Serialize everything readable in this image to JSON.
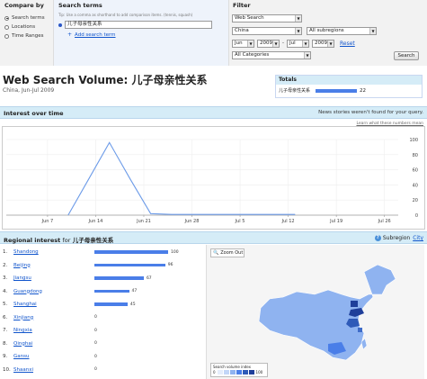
{
  "compare": {
    "heading": "Compare by",
    "options": [
      "Search terms",
      "Locations",
      "Time Ranges"
    ]
  },
  "terms": {
    "heading": "Search terms",
    "tip": "Tip: Use a comma as shorthand to add comparison items. (tennis, squash)",
    "term_value": "儿子母亲性关系",
    "add_label": "Add search term"
  },
  "filter": {
    "heading": "Filter",
    "property": "Web Search",
    "country": "China",
    "subregion": "All subregions",
    "from_month": "Jun",
    "from_year": "2009",
    "to_month": "Jul",
    "to_year": "2009",
    "category": "All Categories",
    "reset_label": "Reset",
    "search_label": "Search"
  },
  "header": {
    "title": "Web Search Volume: 儿子母亲性关系",
    "subtitle": "China, Jun-Jul 2009"
  },
  "totals": {
    "heading": "Totals",
    "term": "儿子母亲性关系",
    "value": "22",
    "bar_fraction": 1.0
  },
  "interest": {
    "heading": "Interest over time",
    "news_note": "News stories weren't found for your query.",
    "learn_link": "Learn what these numbers mean"
  },
  "chart_data": {
    "type": "line",
    "x": [
      "Jun 1",
      "Jun 4",
      "Jun 7",
      "Jun 10",
      "Jun 13",
      "Jun 16",
      "Jun 19",
      "Jun 22",
      "Jun 25",
      "Jun 28",
      "Jul 1",
      "Jul 4",
      "Jul 7",
      "Jul 10",
      "Jul 13",
      "Jul 16",
      "Jul 19",
      "Jul 22",
      "Jul 25",
      "Jul 28"
    ],
    "series": [
      {
        "values": [
          null,
          null,
          null,
          0,
          48,
          96,
          48,
          2,
          1,
          1,
          1,
          1,
          1,
          1,
          1,
          null,
          null,
          null,
          null,
          null
        ]
      }
    ],
    "x_tick_labels": [
      "Jun 7",
      "Jun 14",
      "Jun 21",
      "Jun 28",
      "Jul 5",
      "Jul 12",
      "Jul 19",
      "Jul 26"
    ],
    "y_tick_labels": [
      "0",
      "20",
      "40",
      "60",
      "80",
      "100"
    ],
    "ylim": [
      0,
      100
    ],
    "grid": true,
    "color": "#6c9be8"
  },
  "regional": {
    "heading": "Regional interest",
    "for_label": "for",
    "term": "儿子母亲性关系",
    "subregion_label": "Subregion",
    "city_label": "City",
    "rows": [
      {
        "rank": "1.",
        "name": "Shandong",
        "value": "100"
      },
      {
        "rank": "2.",
        "name": "Beijing",
        "value": "96"
      },
      {
        "rank": "3.",
        "name": "Jiangsu",
        "value": "67"
      },
      {
        "rank": "4.",
        "name": "Guangdong",
        "value": "47"
      },
      {
        "rank": "5.",
        "name": "Shanghai",
        "value": "45"
      },
      {
        "rank": "6.",
        "name": "Xinjiang",
        "value": "0"
      },
      {
        "rank": "7.",
        "name": "Ningxia",
        "value": "0"
      },
      {
        "rank": "8.",
        "name": "Qinghai",
        "value": "0"
      },
      {
        "rank": "9.",
        "name": "Gansu",
        "value": "0"
      },
      {
        "rank": "10.",
        "name": "Shaanxi",
        "value": "0"
      }
    ]
  },
  "map": {
    "zoom_label": "Zoom Out",
    "legend_title": "Search volume index",
    "legend_min": "0",
    "legend_max": "100",
    "base_color": "#8fb3f0",
    "dark_color": "#1f3f9a"
  }
}
